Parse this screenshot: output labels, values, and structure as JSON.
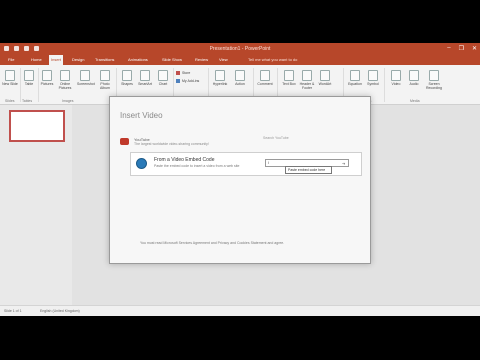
{
  "app": {
    "title": "Presentation1 - PowerPoint",
    "window_controls": [
      "–",
      "❐",
      "✕"
    ]
  },
  "ribbon_tabs": [
    "File",
    "Home",
    "Insert",
    "Design",
    "Transitions",
    "Animations",
    "Slide Show",
    "Review",
    "View"
  ],
  "active_tab": "Insert",
  "tell_me": "Tell me what you want to do",
  "ribbon": {
    "new_slide": "New Slide",
    "table": "Table",
    "pictures": "Pictures",
    "online_pictures": "Online Pictures",
    "screenshot": "Screenshot",
    "photo_album": "Photo Album",
    "shapes": "Shapes",
    "smartart": "SmartArt",
    "chart": "Chart",
    "store": "Store",
    "my_addins": "My Add-ins",
    "hyperlink": "Hyperlink",
    "action": "Action",
    "comment": "Comment",
    "text_box": "Text Box",
    "header_footer": "Header & Footer",
    "wordart": "WordArt",
    "equation": "Equation",
    "symbol": "Symbol",
    "video": "Video",
    "audio": "Audio",
    "screen_recording": "Screen Recording",
    "groups": {
      "slides": "Slides",
      "tables": "Tables",
      "images": "Images",
      "illustrations": "Illustrations",
      "addins": "Add-ins",
      "links": "Links",
      "comments": "Comments",
      "text": "Text",
      "symbols": "Symbols",
      "media": "Media"
    }
  },
  "dialog": {
    "title": "Insert Video",
    "youtube": {
      "label": "YouTube",
      "description": "The largest worldwide video-sharing community!",
      "placeholder": "Search YouTube"
    },
    "embed": {
      "label": "From a Video Embed Code",
      "description": "Paste the embed code to insert a video from a web site",
      "value": "I"
    },
    "tooltip": "Paste embed code here",
    "note": "You must read Microsoft Services Agreement and Privacy and Cookies Statement and agree."
  },
  "status": {
    "slide": "Slide 1 of 1",
    "language": "English (United Kingdom)"
  },
  "colors": {
    "accent": "#b7472a",
    "slide_selection": "#c0504d"
  }
}
